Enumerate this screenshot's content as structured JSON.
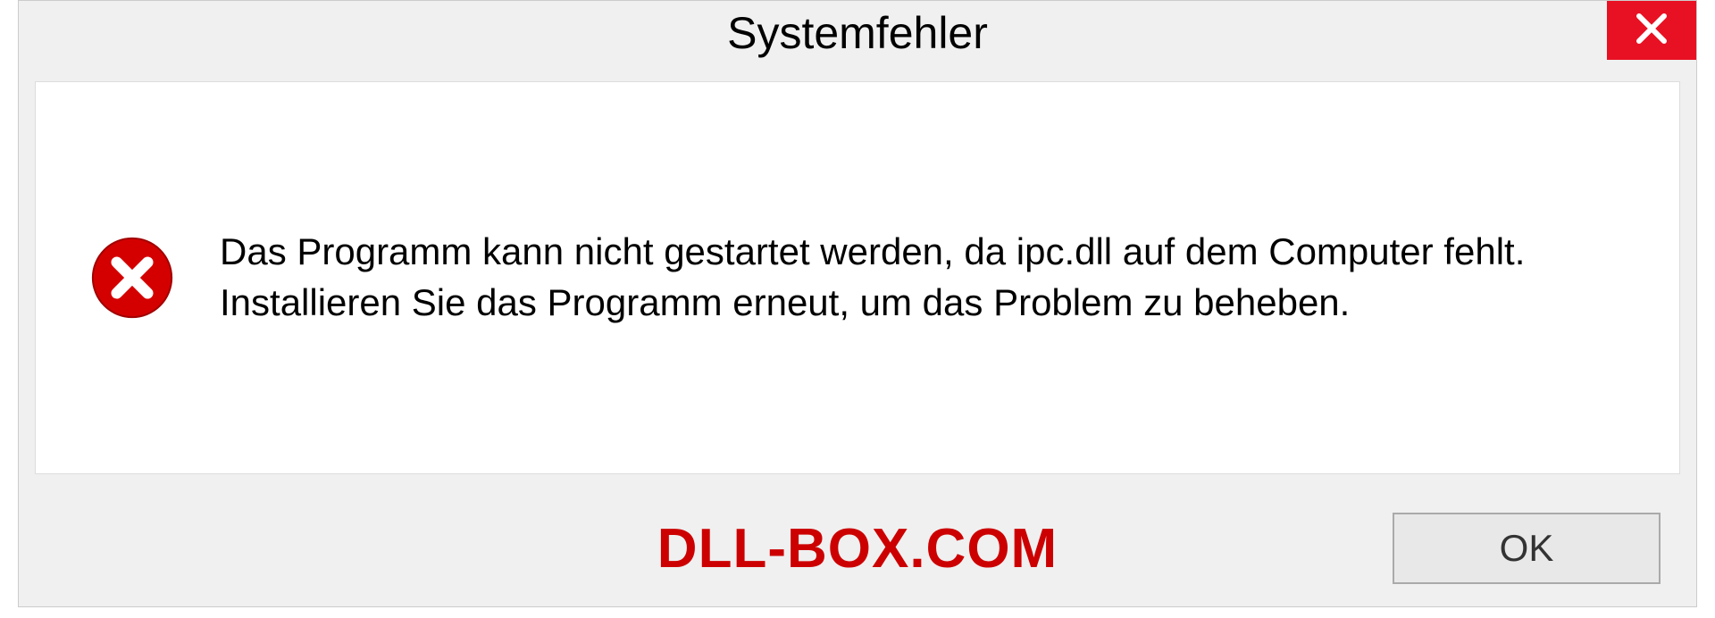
{
  "dialog": {
    "title": "Systemfehler",
    "message": "Das Programm kann nicht gestartet werden, da ipc.dll auf dem Computer fehlt. Installieren Sie das Programm erneut, um das Problem zu beheben.",
    "ok_label": "OK"
  },
  "watermark": "DLL-BOX.COM",
  "colors": {
    "close_bg": "#e81123",
    "error_icon": "#d40000",
    "watermark": "#cc0000"
  }
}
